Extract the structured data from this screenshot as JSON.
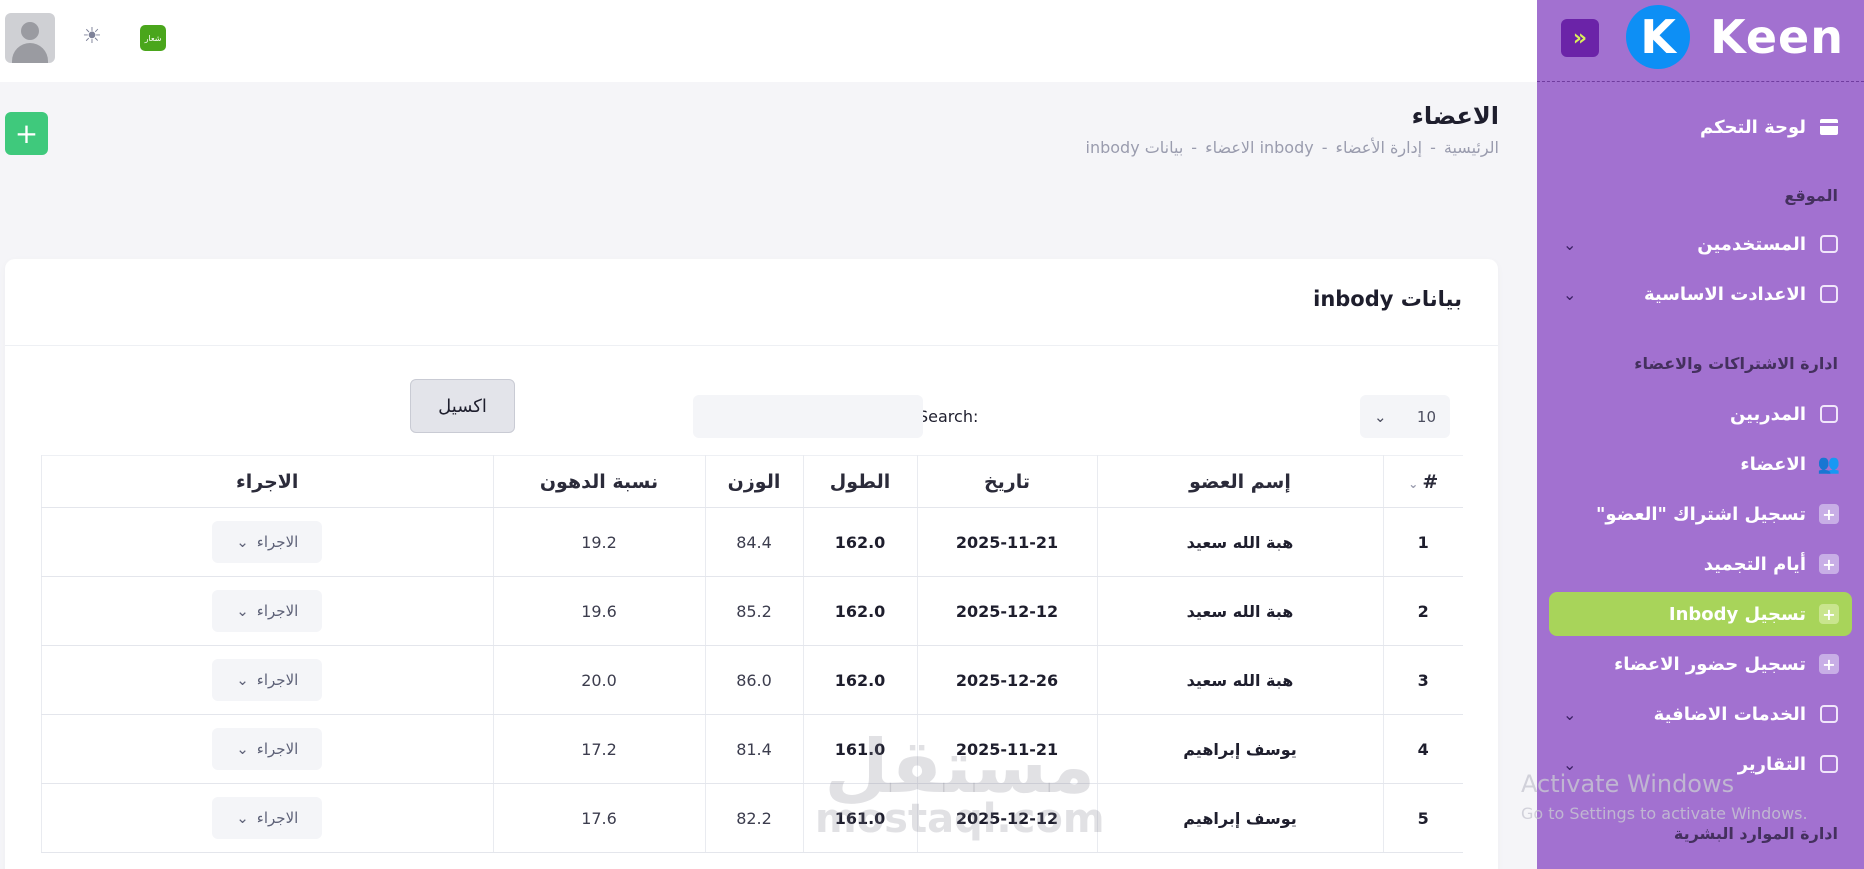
{
  "topbar": {
    "flag_text": "شعار"
  },
  "sidebar": {
    "logo_letter": "K",
    "logo_text": "Keen",
    "toggle_icon": "»",
    "dashboard": "لوحة التحكم",
    "section_site": "الموقع",
    "users": "المستخدمين",
    "settings": "الاعدادت الاساسية",
    "section_subs": "ادارة الاشتراكات والاعضاء",
    "trainers": "المدربين",
    "members": "الاعضاء",
    "register_sub": "تسجيل اشتراك \"العضو\"",
    "freeze_days": "أيام التجميد",
    "inbody": "تسجيل Inbody",
    "attendance": "تسجيل حضور الاعضاء",
    "services": "الخدمات الاضافية",
    "reports": "التقارير",
    "section_hr": "ادارة الموارد البشرية"
  },
  "header": {
    "title": "الاعضاء",
    "breadcrumb": [
      "الرئيسية",
      "إدارة الأعضاء",
      "inbody الاعضاء",
      "بيانات inbody"
    ]
  },
  "card": {
    "title": "بيانات inbody",
    "page_length": "10",
    "search_label": "Search:",
    "excel_label": "اكسيل",
    "columns": [
      "#",
      "إسم العضو",
      "تاريخ",
      "الطول",
      "الوزن",
      "نسبة الدهون",
      "الاجراء"
    ],
    "rows": [
      {
        "n": "1",
        "name": "هبة الله سعيد",
        "date": "2025-11-21",
        "height": "162.0",
        "weight": "84.4",
        "fat": "19.2",
        "action": "الاجراء"
      },
      {
        "n": "2",
        "name": "هبة الله سعيد",
        "date": "2025-12-12",
        "height": "162.0",
        "weight": "85.2",
        "fat": "19.6",
        "action": "الاجراء"
      },
      {
        "n": "3",
        "name": "هبة الله سعيد",
        "date": "2025-12-26",
        "height": "162.0",
        "weight": "86.0",
        "fat": "20.0",
        "action": "الاجراء"
      },
      {
        "n": "4",
        "name": "يوسف إبراهيم",
        "date": "2025-11-21",
        "height": "161.0",
        "weight": "81.4",
        "fat": "17.2",
        "action": "الاجراء"
      },
      {
        "n": "5",
        "name": "يوسف إبراهيم",
        "date": "2025-12-12",
        "height": "161.0",
        "weight": "82.2",
        "fat": "17.6",
        "action": "الاجراء"
      }
    ]
  },
  "watermark": {
    "line1": "مستقل",
    "line2": "mostaql.com"
  },
  "activate": {
    "title": "Activate Windows",
    "sub": "Go to Settings to activate Windows."
  },
  "colors": {
    "sidebar": "#a271d0",
    "active": "#a8d45a",
    "add": "#3fc97c",
    "toggle": "#6b23a8"
  }
}
